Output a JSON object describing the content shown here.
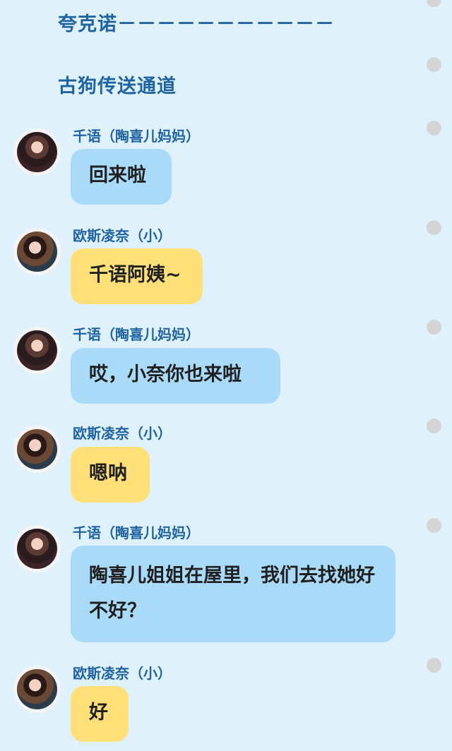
{
  "header": {
    "line1": "夸克诺－－－－－－－－－－－",
    "line2": "古狗传送通道"
  },
  "messages": [
    {
      "speaker": "千语（陶喜儿妈妈）",
      "text": "回来啦",
      "color": "#a9dbf9",
      "avatar": "qianyu-avatar"
    },
    {
      "speaker": "欧斯凌奈（小）",
      "text": "千语阿姨~",
      "color": "#ffdf78",
      "avatar": "ousilingnai-avatar"
    },
    {
      "speaker": "千语（陶喜儿妈妈）",
      "text": "哎，小奈你也来啦",
      "color": "#a9dbf9",
      "avatar": "qianyu-avatar"
    },
    {
      "speaker": "欧斯凌奈（小）",
      "text": "嗯呐",
      "color": "#ffdf78",
      "avatar": "ousilingnai-avatar"
    },
    {
      "speaker": "千语（陶喜儿妈妈）",
      "text": "陶喜儿姐姐在屋里，我们去找她好不好？",
      "color": "#a9dbf9",
      "avatar": "qianyu-avatar"
    },
    {
      "speaker": "欧斯凌奈（小）",
      "text": "好",
      "color": "#ffdf78",
      "avatar": "ousilingnai-avatar"
    }
  ]
}
